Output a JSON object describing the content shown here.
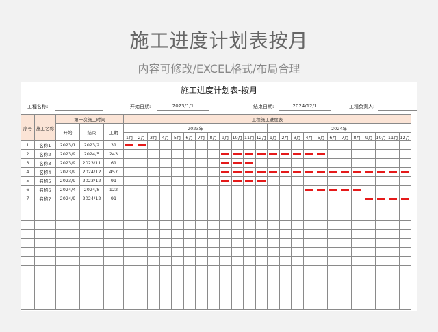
{
  "hero": {
    "title": "施工进度计划表按月",
    "subtitle": "内容可修改/EXCEL格式/布局合理"
  },
  "sheet": {
    "title": "施工进度计划表-按月",
    "info": {
      "project_name_label": "工程名称:",
      "start_date_label": "开始日期:",
      "start_date_value": "2023/1/1",
      "end_date_label": "结束日期:",
      "end_date_value": "2024/12/1",
      "manager_label": "工程负责人:"
    },
    "headers": {
      "seq": "序号",
      "name": "施工名称",
      "first_time": "第一次施工时间",
      "start": "开始",
      "end": "结束",
      "period": "工期",
      "progress_table": "工程施工进度表",
      "years": [
        "2023年",
        "2024年"
      ],
      "months": [
        "1月",
        "2月",
        "3月",
        "4月",
        "5月",
        "6月",
        "7月",
        "8月",
        "9月",
        "10月",
        "11月",
        "12月",
        "1月",
        "2月",
        "3月",
        "4月",
        "5月",
        "6月",
        "7月",
        "8月",
        "9月",
        "10月",
        "11月",
        "12月"
      ]
    },
    "rows": [
      {
        "seq": "1",
        "name": "名称1",
        "start": "2023/1",
        "end": "2023/2",
        "period": "31",
        "bar_from": 0,
        "bar_to": 1
      },
      {
        "seq": "2",
        "name": "名称2",
        "start": "2023/9",
        "end": "2024/5",
        "period": "243",
        "bar_from": 8,
        "bar_to": 16
      },
      {
        "seq": "3",
        "name": "名称3",
        "start": "2023/9",
        "end": "2023/11",
        "period": "61",
        "bar_from": 8,
        "bar_to": 10
      },
      {
        "seq": "4",
        "name": "名称4",
        "start": "2023/9",
        "end": "2024/12",
        "period": "457",
        "bar_from": 8,
        "bar_to": 23
      },
      {
        "seq": "5",
        "name": "名称5",
        "start": "2023/9",
        "end": "2023/12",
        "period": "91",
        "bar_from": 8,
        "bar_to": 11
      },
      {
        "seq": "6",
        "name": "名称6",
        "start": "2024/4",
        "end": "2024/8",
        "period": "122",
        "bar_from": 15,
        "bar_to": 19
      },
      {
        "seq": "7",
        "name": "名称7",
        "start": "2024/9",
        "end": "2024/12",
        "period": "91",
        "bar_from": 20,
        "bar_to": 23
      }
    ],
    "blank_rows": 12,
    "bar_color": "#e51a1a",
    "header_fill": "#fbe4d6"
  }
}
